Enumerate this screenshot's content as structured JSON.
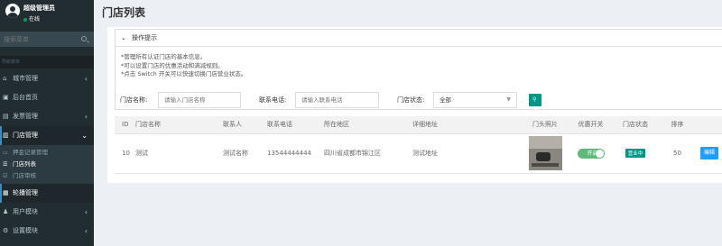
{
  "user": {
    "name": "超级管理员",
    "status": "在线"
  },
  "search": {
    "placeholder": "搜索菜单"
  },
  "menu_header": "导航菜单",
  "menu": [
    {
      "label": "城市管理",
      "icon": "home-icon",
      "glyph": "⌂"
    },
    {
      "label": "后台首页",
      "icon": "dashboard-icon",
      "glyph": "▣"
    },
    {
      "label": "发票管理",
      "icon": "invoice-icon",
      "glyph": "▤"
    },
    {
      "label": "门店管理",
      "icon": "store-icon",
      "glyph": "▥"
    },
    {
      "label": "轮播管理",
      "icon": "carousel-icon",
      "glyph": "▦"
    },
    {
      "label": "用户模块",
      "icon": "user-icon",
      "glyph": "♟"
    },
    {
      "label": "设置模块",
      "icon": "settings-icon",
      "glyph": "⚙"
    }
  ],
  "submenu": [
    {
      "label": "押金记录管理",
      "glyph": "▭"
    },
    {
      "label": "门店列表",
      "glyph": "☰"
    },
    {
      "label": "门店审核",
      "glyph": "☑"
    }
  ],
  "page": {
    "title": "门店列表"
  },
  "tips": {
    "header": "操作提示",
    "lines": [
      "*管理所有认证门店的基本信息。",
      "*可以设置门店的优惠活动和满减规则。",
      "*点击 Switch 开关可以快速切换门店营业状态。"
    ]
  },
  "filters": {
    "store_name_label": "门店名称:",
    "store_name_placeholder": "请输入门店名称",
    "phone_label": "联系电话:",
    "phone_placeholder": "请输入联系电话",
    "status_label": "门店状态:",
    "status_value": "全部",
    "search_button": "搜索"
  },
  "table": {
    "headers": [
      "ID",
      "门店名称",
      "联系人",
      "联系电话",
      "所在地区",
      "详细地址",
      "门头照片",
      "优惠开关",
      "门店状态",
      "排序",
      ""
    ],
    "rows": [
      {
        "id": "10",
        "name": "测试",
        "contact": "测试名称",
        "phone": "13544444444",
        "region": "四川省成都市锦江区",
        "address": "测试地址",
        "discount_switch": "开启",
        "status": "营业中",
        "sort": "50",
        "action": "编辑"
      }
    ]
  }
}
